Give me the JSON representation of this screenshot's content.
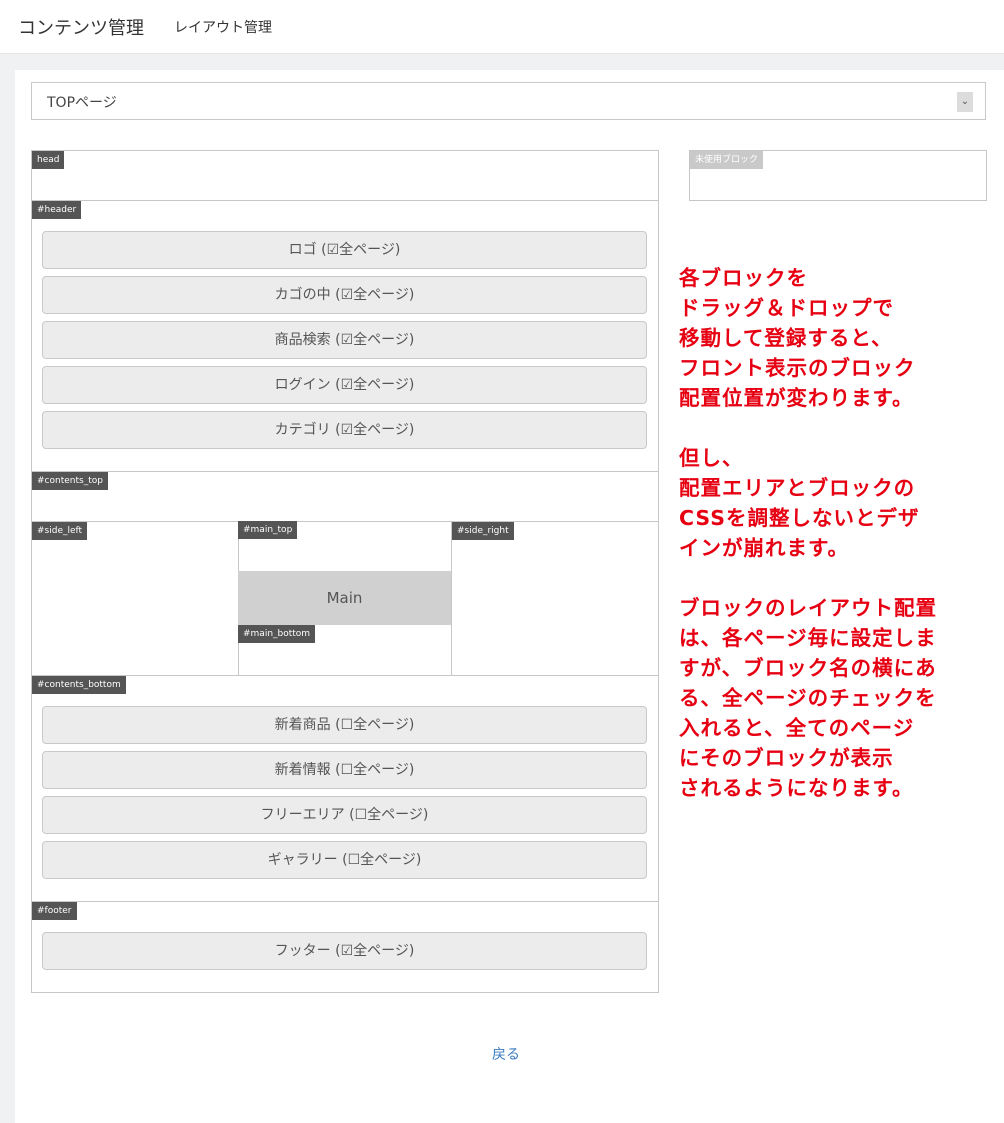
{
  "header": {
    "title": "コンテンツ管理",
    "subtitle": "レイアウト管理"
  },
  "page_select": {
    "value": "TOPページ",
    "arrow": "⌄"
  },
  "unused": {
    "label": "未使用ブロック"
  },
  "layout": {
    "head": {
      "label": "head"
    },
    "header": {
      "label": "#header",
      "blocks": [
        {
          "name": "ロゴ",
          "checked": true
        },
        {
          "name": "カゴの中",
          "checked": true
        },
        {
          "name": "商品検索",
          "checked": true
        },
        {
          "name": "ログイン",
          "checked": true
        },
        {
          "name": "カテゴリ",
          "checked": true
        }
      ]
    },
    "contents_top": {
      "label": "#contents_top"
    },
    "side_left": {
      "label": "#side_left"
    },
    "main_top": {
      "label": "#main_top"
    },
    "main": {
      "label": "Main"
    },
    "main_bottom": {
      "label": "#main_bottom"
    },
    "side_right": {
      "label": "#side_right"
    },
    "contents_bottom": {
      "label": "#contents_bottom",
      "blocks": [
        {
          "name": "新着商品",
          "checked": false
        },
        {
          "name": "新着情報",
          "checked": false
        },
        {
          "name": "フリーエリア",
          "checked": false
        },
        {
          "name": "ギャラリー",
          "checked": false
        }
      ]
    },
    "footer": {
      "label": "#footer",
      "blocks": [
        {
          "name": "フッター",
          "checked": true
        }
      ]
    },
    "all_pages_label": "全ページ",
    "check_on": "☑",
    "check_off": "☐"
  },
  "annotation": {
    "lines": [
      "各ブロックを",
      "ドラッグ＆ドロップで",
      "移動して登録すると、",
      "フロント表示のブロック",
      "配置位置が変わります。",
      "",
      "但し、",
      "配置エリアとブロックの",
      "CSSを調整しないとデザ",
      "インが崩れます。",
      "",
      "ブロックのレイアウト配置",
      "は、各ページ毎に設定しま",
      "すが、ブロック名の横にあ",
      "る、全ページのチェックを",
      "入れると、全てのページ",
      "にそのブロックが表示",
      "されるようになります。"
    ]
  },
  "back_link": "戻る"
}
